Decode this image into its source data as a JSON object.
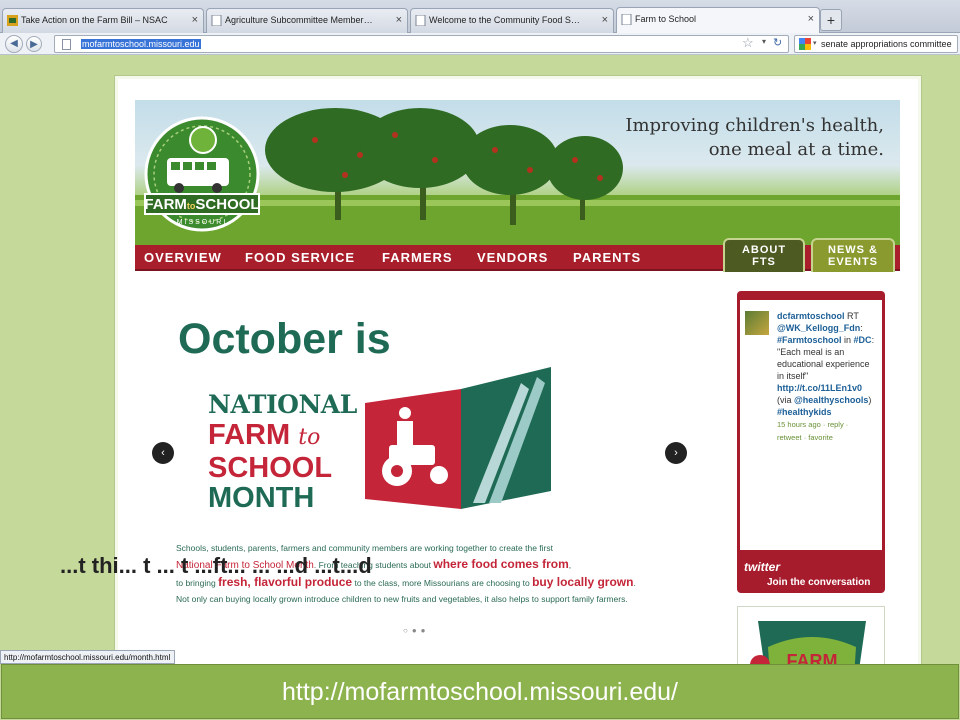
{
  "browser": {
    "tabs": [
      {
        "label": "Take Action on the Farm Bill – NSAC",
        "active": false
      },
      {
        "label": "Agriculture Subcommittee Members | Co...",
        "active": false
      },
      {
        "label": "Welcome to the Community Food Securit...",
        "active": false
      },
      {
        "label": "Farm to School",
        "active": true
      }
    ],
    "new_tab_label": "+",
    "url": "mofarmtoschool.missouri.edu",
    "search_query": "senate appropriations committee",
    "status_url": "http://mofarmtoschool.missouri.edu/month.html"
  },
  "site": {
    "tagline_line1": "Improving children's health,",
    "tagline_line2": "one meal at a time.",
    "logo": {
      "top": "FARM",
      "to": "to",
      "bottom": "SCHOOL",
      "state": "MISSOURI"
    },
    "nav": [
      "OVERVIEW",
      "FOOD SERVICE",
      "FARMERS",
      "VENDORS",
      "PARENTS"
    ],
    "side_tabs": [
      {
        "line1": "ABOUT",
        "line2": "FTS"
      },
      {
        "line1": "NEWS &",
        "line2": "EVENTS"
      }
    ],
    "slide": {
      "headline": "October is",
      "nfs_line1": "NATIONAL",
      "nfs_line2_a": "FARM",
      "nfs_line2_b": "to",
      "nfs_line3": "SCHOOL",
      "nfs_line4": "MONTH",
      "body_line1": "Schools, students, parents, farmers and community members are working together to create the first",
      "body_line2_a": "National Farm to School Month",
      "body_line2_b": ". From teaching students about ",
      "body_line2_c": "where food comes from",
      "body_line2_d": ",",
      "body_line3_a": "to bringing ",
      "body_line3_b": "fresh, flavorful produce",
      "body_line3_c": " to the class, more Missourians are choosing to ",
      "body_line3_d": "buy locally grown",
      "body_line3_e": ".",
      "body_line4": "Not only can buying locally grown introduce children to new fruits and vegetables, it also helps to support family farmers.",
      "prev": "‹",
      "next": "›",
      "dots": "○●●"
    },
    "partial_heading": "...t thi... t ... t ...ft... ... ...d ...t...d",
    "twitter": {
      "user": "dcfarmtoschool",
      "rt": " RT",
      "mention1": "@WK_Kellogg_Fdn",
      "colon": ":",
      "hashtag1": "#Farmtoschool",
      "in_word": " in",
      "hashtag2": "#DC",
      "quote": ": \"Each meal is an educational experience in itself\"",
      "link": "http://t.co/11LEn1v0",
      "via": "(via",
      "mention2": "@healthyschools",
      "close": ")",
      "hashtag3": "#healthykids",
      "time": "15 hours ago",
      "reply": " · reply · ",
      "retweet": "retweet",
      "favorite": " · favorite",
      "brand": "twitter",
      "join": "Join the conversation"
    },
    "promo_text": "FARM"
  },
  "caption": "http://mofarmtoschool.missouri.edu/",
  "colors": {
    "nav_red": "#a81f2b",
    "brand_green": "#1e6a55",
    "brand_red": "#c42538",
    "slide_bg": "#c5d99b"
  }
}
